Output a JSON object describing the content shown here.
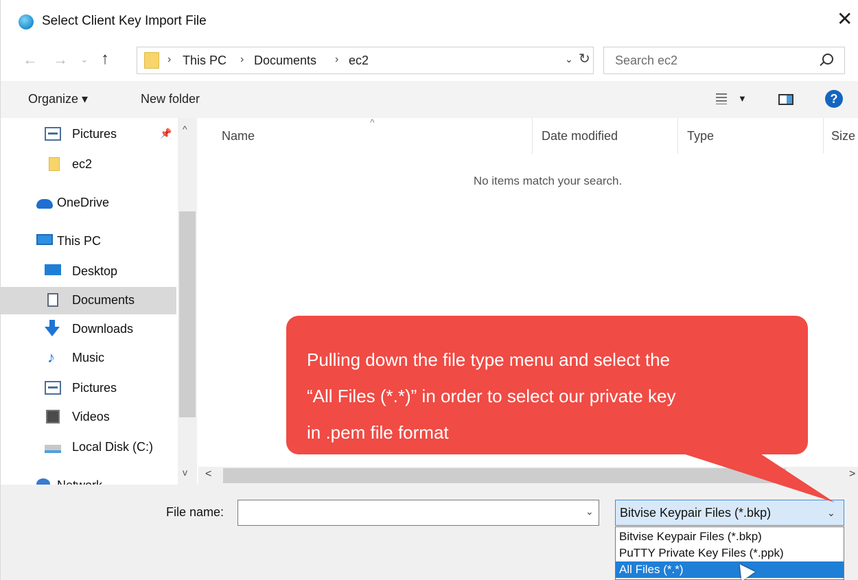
{
  "window": {
    "title": "Select Client Key Import File"
  },
  "address": {
    "crumbs": [
      "This PC",
      "Documents",
      "ec2"
    ],
    "separator": "›"
  },
  "search": {
    "placeholder": "Search ec2"
  },
  "toolbar": {
    "organize": "Organize ▾",
    "new_folder": "New folder"
  },
  "navpane": {
    "items": [
      {
        "label": "Pictures",
        "icon": "pictures-icon"
      },
      {
        "label": "ec2",
        "icon": "folder-icon"
      },
      {
        "label": "OneDrive",
        "icon": "onedrive-icon"
      },
      {
        "label": "This PC",
        "icon": "this-pc-icon"
      },
      {
        "label": "Desktop",
        "icon": "desktop-icon"
      },
      {
        "label": "Documents",
        "icon": "documents-icon",
        "selected": true
      },
      {
        "label": "Downloads",
        "icon": "downloads-icon"
      },
      {
        "label": "Music",
        "icon": "music-icon"
      },
      {
        "label": "Pictures",
        "icon": "pictures-icon"
      },
      {
        "label": "Videos",
        "icon": "videos-icon"
      },
      {
        "label": "Local Disk (C:)",
        "icon": "local-disk-icon"
      },
      {
        "label": "Network",
        "icon": "network-icon"
      }
    ]
  },
  "filelist": {
    "columns": [
      "Name",
      "Date modified",
      "Type",
      "Size"
    ],
    "empty_message": "No items match your search."
  },
  "bottom": {
    "file_name_label": "File name:",
    "file_name_value": "",
    "file_type_selected": "Bitvise Keypair Files (*.bkp)",
    "file_type_options": [
      "Bitvise Keypair Files (*.bkp)",
      "PuTTY Private Key Files (*.ppk)",
      "All Files (*.*)"
    ],
    "highlighted_option_index": 2
  },
  "callout": {
    "line1": "Pulling down the file type menu and select the",
    "line2": "“All Files (*.*)”  in order to select our private key",
    "line3": "in  .pem file format",
    "color": "#f04b45"
  },
  "colors": {
    "accent": "#1f7fd6",
    "selection": "#d9d9d9",
    "callout": "#f04b45"
  }
}
